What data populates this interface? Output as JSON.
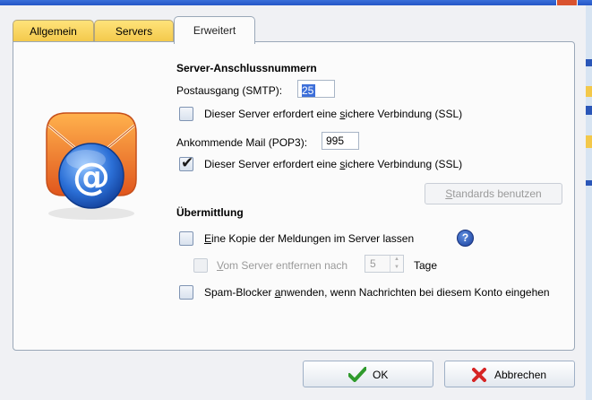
{
  "tabs": [
    {
      "label": "Allgemein",
      "active": false
    },
    {
      "label": "Servers",
      "active": false
    },
    {
      "label": "Erweitert",
      "active": true
    }
  ],
  "server_ports": {
    "section_title": "Server-Anschlussnummern",
    "outgoing_label": "Postausgang (SMTP):",
    "outgoing_value": "25",
    "outgoing_ssl_prefix": "Dieser Server erfordert eine ",
    "outgoing_ssl_accel": "s",
    "outgoing_ssl_suffix": "ichere Verbindung (SSL)",
    "outgoing_ssl_checked": false,
    "incoming_label": "Ankommende Mail (POP3):",
    "incoming_value": "995",
    "incoming_ssl_prefix": "Dieser Server erfordert eine ",
    "incoming_ssl_accel": "s",
    "incoming_ssl_suffix": "ichere Verbindung (SSL)",
    "incoming_ssl_checked": true,
    "defaults_button_accel": "S",
    "defaults_button_rest": "tandards benutzen"
  },
  "delivery": {
    "section_title": "Übermittlung",
    "keep_copy_accel": "E",
    "keep_copy_rest": "ine Kopie der Meldungen im Server lassen",
    "keep_copy_checked": false,
    "remove_accel": "V",
    "remove_rest": "om Server entfernen nach",
    "remove_checked": false,
    "remove_days_value": "5",
    "remove_days_unit": "Tage",
    "spam_prefix": "Spam-Blocker ",
    "spam_accel": "a",
    "spam_suffix": "nwenden, wenn Nachrichten bei diesem Konto eingehen",
    "spam_checked": false
  },
  "buttons": {
    "ok_label": "OK",
    "cancel_label": "Abbrechen"
  },
  "icons": {
    "mail_account": "email-at-envelope-icon",
    "help": "help-question-icon",
    "ok": "green-checkmark-icon",
    "cancel": "red-x-icon"
  },
  "colors": {
    "tab_inactive": "#f3c84a",
    "envelope": "#f07a2b",
    "at_badge": "#2b6fd6"
  }
}
